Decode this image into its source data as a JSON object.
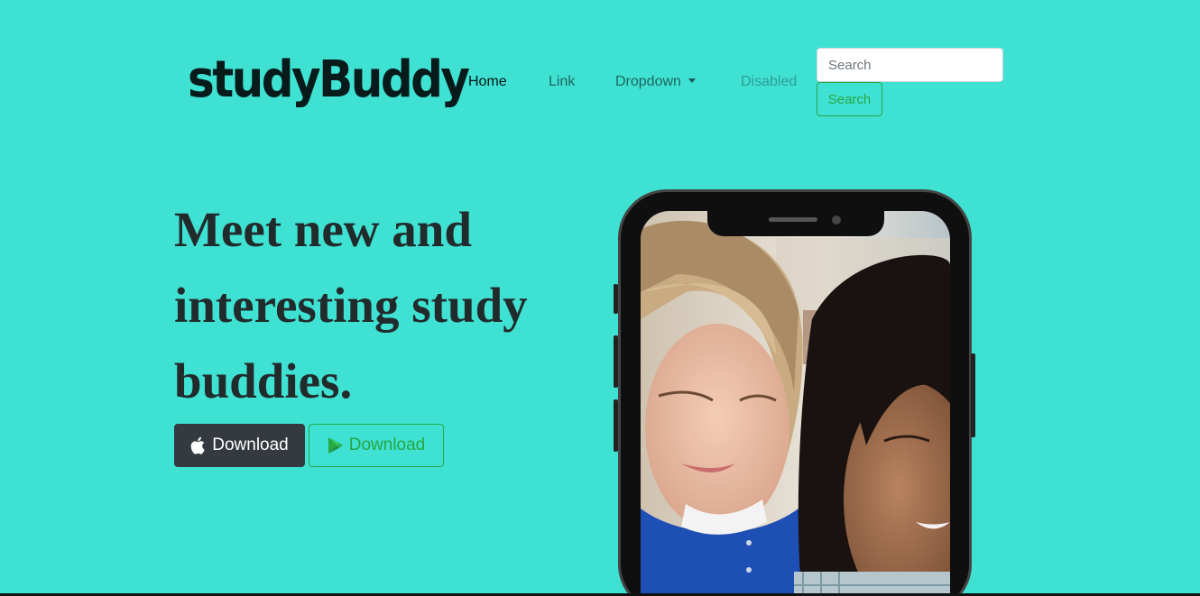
{
  "brand": {
    "name": "studyBuddy"
  },
  "nav": {
    "home": "Home",
    "link": "Link",
    "dropdown": "Dropdown",
    "disabled": "Disabled"
  },
  "search": {
    "placeholder": "Search",
    "button_label": "Search"
  },
  "hero": {
    "title": "Meet new and interesting study buddies.",
    "apple_button": "Download",
    "google_button": "Download"
  },
  "colors": {
    "background": "#3fe1d2",
    "accent": "#28a745",
    "dark_button": "#343a40"
  },
  "icons": {
    "apple": "apple-icon",
    "google_play": "google-play-icon",
    "dropdown": "caret-down-icon"
  }
}
